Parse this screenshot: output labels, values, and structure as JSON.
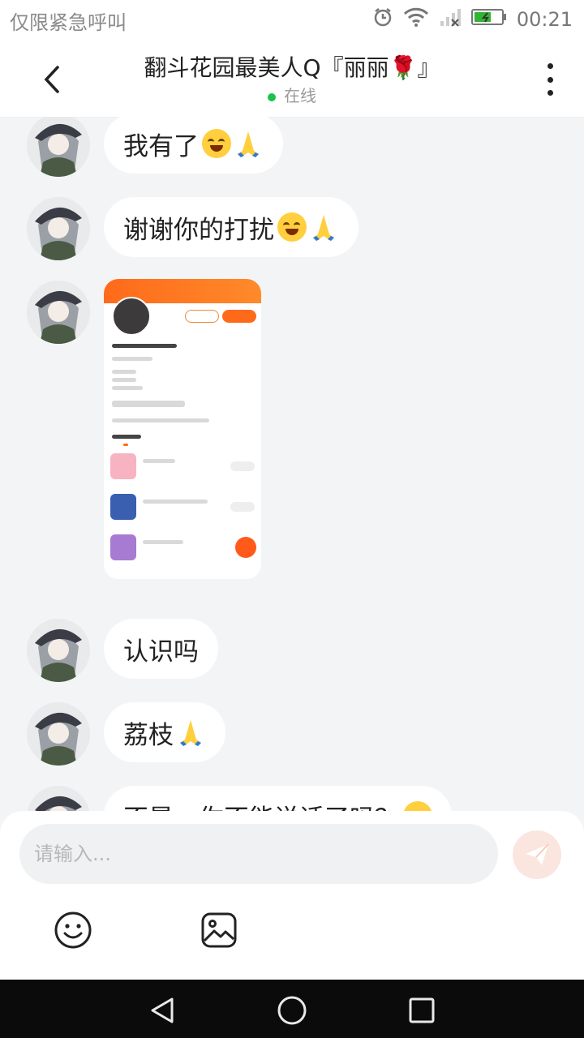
{
  "status_bar": {
    "carrier_text": "仅限紧急呼叫",
    "time": "00:21",
    "icons": [
      "alarm-icon",
      "wifi-icon",
      "signal-icon",
      "battery-icon"
    ]
  },
  "header": {
    "title": "翻斗花园最美人Q『丽丽🌹』",
    "online_status": "在线",
    "back_icon": "chevron-left-icon",
    "more_icon": "more-vertical-icon"
  },
  "messages": [
    {
      "type": "text",
      "text": "我有了",
      "emojis": [
        "smile-sweat",
        "pray"
      ]
    },
    {
      "type": "text",
      "text": "谢谢你的打扰",
      "emojis": [
        "smile-sweat",
        "pray"
      ]
    },
    {
      "type": "image",
      "description_icon": "profile-screenshot-image"
    },
    {
      "type": "text",
      "text": "认识吗",
      "emojis": []
    },
    {
      "type": "text",
      "text": "荔枝",
      "emojis": [
        "pray"
      ]
    },
    {
      "type": "text",
      "text": "不是，你不能说话了吗？",
      "emojis": [
        "smile-sweat"
      ]
    }
  ],
  "input": {
    "placeholder": "请输入...",
    "send_icon": "send-icon",
    "tools": [
      "emoji-icon",
      "image-icon"
    ]
  },
  "colors": {
    "accent": "#ff6a1a",
    "chat_bg": "#f3f4f6",
    "online_dot": "#19c24a",
    "send_button_bg": "#fbe5df"
  },
  "navigation": [
    "back-triangle-icon",
    "home-circle-icon",
    "recents-square-icon"
  ]
}
